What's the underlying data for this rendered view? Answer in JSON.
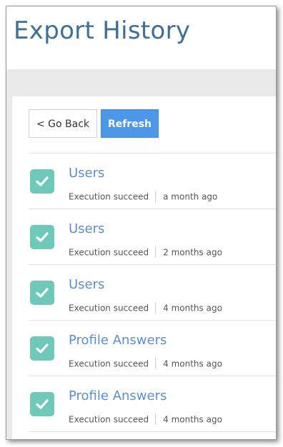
{
  "page": {
    "title": "Export History"
  },
  "toolbar": {
    "back_label": "< Go Back",
    "refresh_label": "Refresh"
  },
  "colors": {
    "title": "#3f6f95",
    "accent": "#4c97e8",
    "success": "#6fc9b9",
    "link": "#5a8fd0"
  },
  "icons": {
    "status": "check-icon"
  },
  "exports": [
    {
      "name": "Users",
      "status": "Execution succeed",
      "time": "a month ago"
    },
    {
      "name": "Users",
      "status": "Execution succeed",
      "time": "2 months ago"
    },
    {
      "name": "Users",
      "status": "Execution succeed",
      "time": "4 months ago"
    },
    {
      "name": "Profile Answers",
      "status": "Execution succeed",
      "time": "4 months ago"
    },
    {
      "name": "Profile Answers",
      "status": "Execution succeed",
      "time": "4 months ago"
    }
  ]
}
